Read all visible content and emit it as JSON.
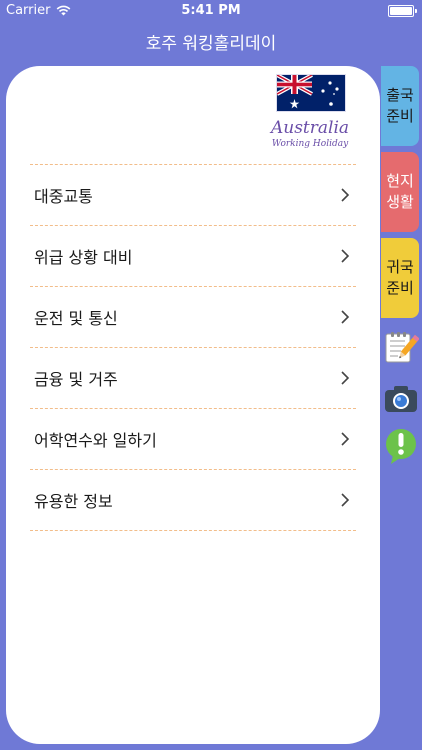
{
  "status_bar": {
    "carrier": "Carrier",
    "time": "5:41 PM"
  },
  "nav": {
    "title": "호주 워킹홀리데이"
  },
  "logo": {
    "line1": "Australia",
    "line2": "Working Holiday"
  },
  "menu": [
    {
      "label": "대중교통"
    },
    {
      "label": "위급 상황 대비"
    },
    {
      "label": "운전 및 통신"
    },
    {
      "label": "금융 및 거주"
    },
    {
      "label": "어학연수와 일하기"
    },
    {
      "label": "유용한 정보"
    }
  ],
  "tabs": [
    {
      "line1": "출국",
      "line2": "준비",
      "color": "#63b4e4"
    },
    {
      "line1": "현지",
      "line2": "생활",
      "color": "#e56b6e"
    },
    {
      "line1": "귀국",
      "line2": "준비",
      "color": "#f0cc3a"
    }
  ],
  "side_icons": [
    "memo-pencil-icon",
    "camera-icon",
    "exclamation-bubble-icon"
  ],
  "colors": {
    "background": "#6f79d6",
    "divider": "#f2bd8a",
    "logo_text": "#6a4ea8"
  }
}
